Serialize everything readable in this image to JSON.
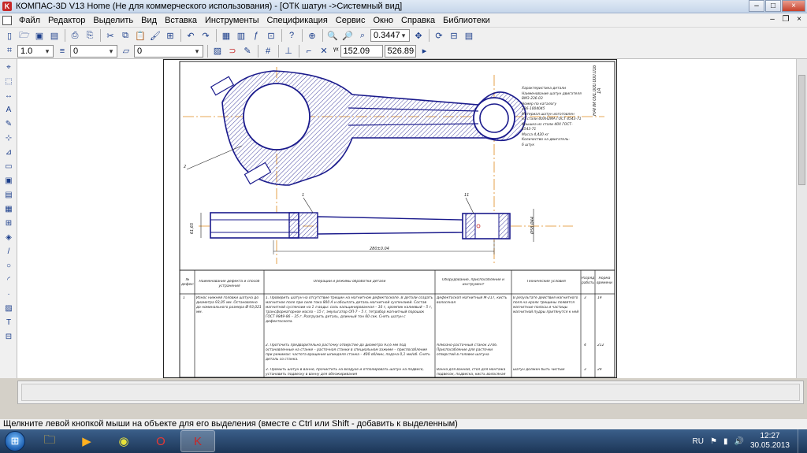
{
  "window": {
    "title": "КОМПАС-3D V13 Home (Не для коммерческого использования) - [ОТК шатун ->Системный вид]",
    "controls": [
      "‒",
      "□",
      "×"
    ]
  },
  "menu": {
    "items": [
      "Файл",
      "Редактор",
      "Выделить",
      "Вид",
      "Вставка",
      "Инструменты",
      "Спецификация",
      "Сервис",
      "Окно",
      "Справка",
      "Библиотеки"
    ]
  },
  "toolbar1": {
    "zoom_value": "0.3447"
  },
  "toolbar2": {
    "scale_value": "1.0",
    "layer_value": "0",
    "style_value": "0",
    "coord_x": "152.09",
    "coord_y": "526.89"
  },
  "drawing": {
    "stamp_text": "НАПМ 091.000.000.016 1А",
    "notes": [
      "Характеристика детали",
      "Наименование шатун двигателя",
      "ВМЗ-236-03",
      "Номер по каталогу",
      "236-1004045",
      "Материал шатун изготовлен",
      "из стали 40ХН2МА ГОСТ 4543-71",
      "Крышка из стали 40Х ГОСТ-",
      "4543-71",
      "Масса 4,420 кг",
      "Количество на двигатель-",
      "6 штук"
    ],
    "dim_length": "280±0.04",
    "dim_height": "61,65",
    "dim_right": "Ø58 Ø44",
    "callout_1": "1",
    "callout_11": "11",
    "callout_2": "2"
  },
  "process_table": {
    "headers": [
      "№ дефекта",
      "Наименование дефекта и способ устранения",
      "Операции и режимы обработки детали",
      "Оборудование, приспособление и инструмент",
      "Технические условия",
      "Разряд работы",
      "Норма времени"
    ],
    "rows": [
      {
        "num": "1",
        "defect": "Износ нижней головки шатуна до диаметра 93,05 мм. Остановлено до номинального размера Ø 93,021 мм.",
        "operations": "1. Проверить шатун на отсутствие трещин на магнитном дефектоскопе. В детали создать магнитное поле при силе тока 800 А и обсыпать деталь магнитной суспензией. Состав магнитной суспензии на 1 л воды: соль кальцинированная – 10 г, хромпик калиевый – 5 г, трансформаторное масло – 15 г, эмульгатор ОП-7 – 5 г, тетрабор магнитный порошок ГОСТ 9849-86 – 35 г. Разгрузить деталь, длинный тон 60 сек. Снять шатун с дефектоскопа.",
        "equipment": "Дефектоскоп магнитный М-217, кисть волосяная",
        "conditions": "В результате действия магнитного поля на краях трещины появятся магнитные полосы и частицы магнитной пудры притянутся к ней",
        "grade": "3",
        "time": "19"
      },
      {
        "num": "",
        "defect": "",
        "operations": "2. Проточить предварительно расточку отверстие до диаметра 93,6 мм под остановленные на станке – расточная станки в специальном зажиме – приспособление при режимах: частота вращения шпинделя станка – 400 об/мин, подача 0,1 мм/об. Снять деталь со станка.",
        "equipment": "Алмазно-расточный станок 2706. Приспособление для расточки отверстий в головке шатуна",
        "conditions": "",
        "grade": "4",
        "time": "212"
      },
      {
        "num": "",
        "defect": "",
        "operations": "3. Промыть шатун в ванне, прочистить на воздухе и отполировать шатун на подвесе, установить подвеску в ванну для обезжиривания",
        "equipment": "Ванна для ванной, стол для монтажа подвесок, подвеска, кисть волосяная",
        "conditions": "шатун должен быть чистым",
        "grade": "3",
        "time": "29"
      }
    ]
  },
  "status": {
    "message": "Щелкните левой кнопкой мыши на объекте для его выделения (вместе с Ctrl или Shift - добавить к выделенным)"
  },
  "taskbar": {
    "language": "RU",
    "time": "12:27",
    "date": "30.05.2013"
  }
}
